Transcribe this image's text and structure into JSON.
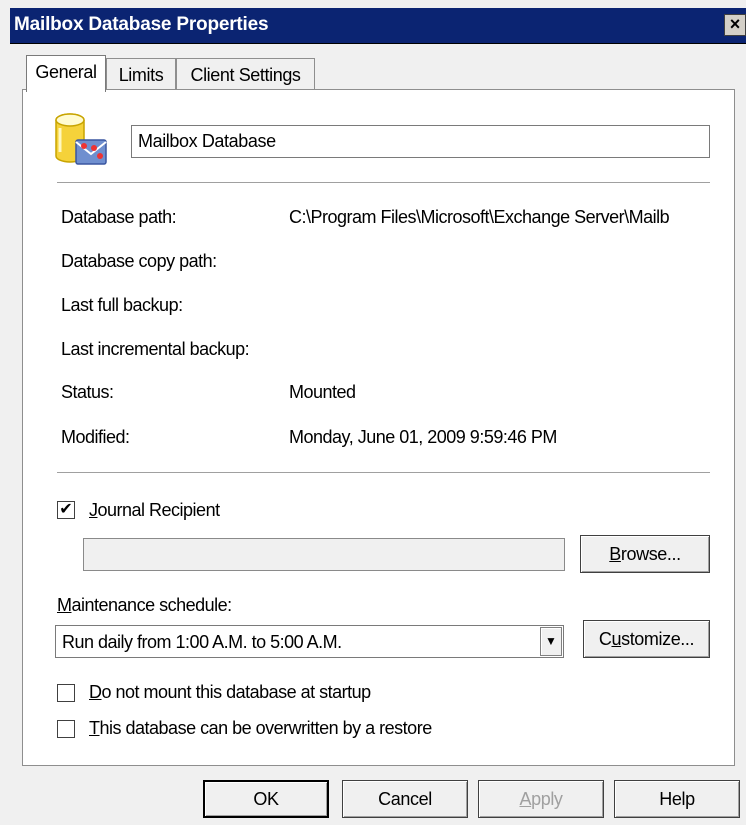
{
  "window": {
    "title": "Mailbox Database Properties",
    "close_glyph": "×"
  },
  "tabs": [
    {
      "label": "General",
      "active": true
    },
    {
      "label": "Limits",
      "active": false
    },
    {
      "label": "Client Settings",
      "active": false
    }
  ],
  "general": {
    "icon": "database-icon",
    "name_value": "Mailbox Database",
    "fields": [
      {
        "label": "Database path:",
        "value": "C:\\Program Files\\Microsoft\\Exchange Server\\Mailb"
      },
      {
        "label": "Database copy path:",
        "value": ""
      },
      {
        "label": "Last full backup:",
        "value": ""
      },
      {
        "label": "Last incremental backup:",
        "value": ""
      },
      {
        "label": "Status:",
        "value": "Mounted"
      },
      {
        "label": "Modified:",
        "value": "Monday, June 01, 2009 9:59:46 PM"
      }
    ],
    "journal": {
      "checked": true,
      "check_glyph": "✔",
      "label_hotkey": "J",
      "label_rest": "ournal Recipient",
      "value": "",
      "browse_hotkey": "B",
      "browse_rest": "rowse..."
    },
    "maintenance": {
      "label_hotkey": "M",
      "label_rest": "aintenance schedule:",
      "selected": "Run daily from 1:00 A.M. to 5:00 A.M.",
      "arrow_glyph": "▼",
      "customize_pre": "C",
      "customize_hotkey": "u",
      "customize_rest": "stomize..."
    },
    "options": [
      {
        "hotkey": "D",
        "rest": "o not mount this database at startup",
        "checked": false
      },
      {
        "hotkey": "T",
        "rest": "his database can be overwritten by a restore",
        "checked": false
      }
    ]
  },
  "footer": {
    "ok": "OK",
    "cancel": "Cancel",
    "apply_hotkey": "A",
    "apply_rest": "pply",
    "help": "Help"
  }
}
